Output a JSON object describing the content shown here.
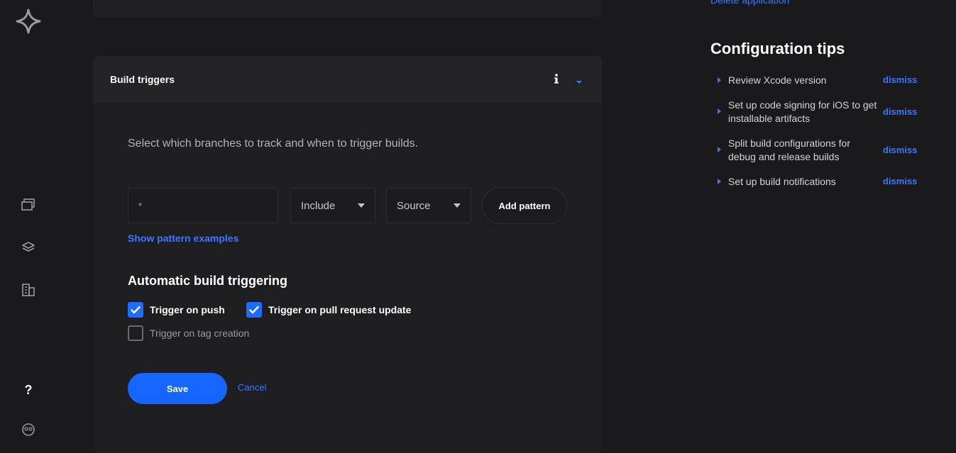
{
  "sidebar": {
    "icons": [
      "logo-icon",
      "apps-icon",
      "stack-icon",
      "buildings-icon",
      "help-icon",
      "avatar-icon"
    ],
    "help_label": "?"
  },
  "card": {
    "title": "Build triggers",
    "description": "Select which branches to track and when to trigger builds.",
    "pattern_input_value": "*",
    "include_select": "Include",
    "source_select": "Source",
    "add_pattern_label": "Add pattern",
    "show_examples_label": "Show pattern examples",
    "section_title": "Automatic build triggering",
    "triggers": [
      {
        "label": "Trigger on push",
        "checked": true
      },
      {
        "label": "Trigger on pull request update",
        "checked": true
      },
      {
        "label": "Trigger on tag creation",
        "checked": false
      }
    ],
    "save_label": "Save",
    "cancel_label": "Cancel"
  },
  "right": {
    "delete_link": "Delete application",
    "tips_title": "Configuration tips",
    "tips": [
      {
        "text": "Review Xcode version",
        "dismiss": "dismiss"
      },
      {
        "text": "Set up code signing for iOS to get installable artifacts",
        "dismiss": "dismiss"
      },
      {
        "text": "Split build configurations for debug and release builds",
        "dismiss": "dismiss"
      },
      {
        "text": "Set up build notifications",
        "dismiss": "dismiss"
      }
    ]
  },
  "colors": {
    "background": "#1a1a1c",
    "accent": "#1565ff",
    "link": "#3a78ff"
  }
}
